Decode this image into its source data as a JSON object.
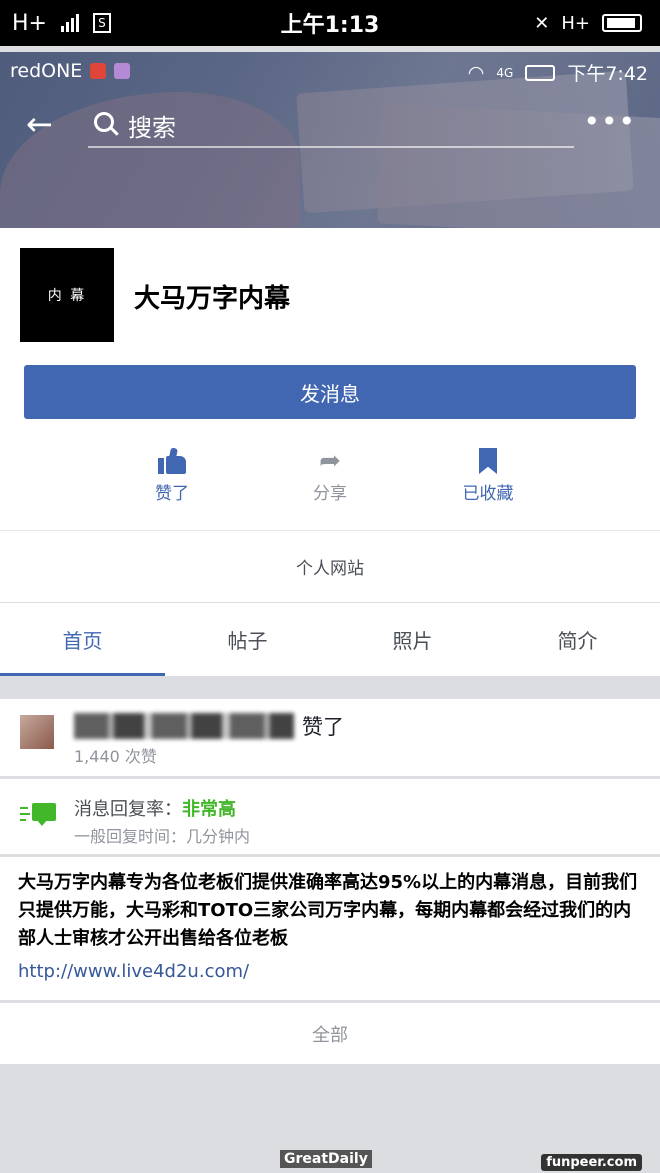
{
  "outer_status": {
    "network": "H+",
    "time": "上午1:13",
    "right_network": "H+"
  },
  "inner_status": {
    "carrier": "redONE",
    "network": "4G",
    "time": "下午7:42"
  },
  "search": {
    "placeholder": "搜索"
  },
  "page": {
    "avatar_text": "内 幕",
    "name": "大马万字内幕"
  },
  "message_button": "发消息",
  "actions": [
    {
      "label": "赞了",
      "icon": "thumbs-up-icon"
    },
    {
      "label": "分享",
      "icon": "share-icon"
    },
    {
      "label": "已收藏",
      "icon": "bookmark-icon"
    }
  ],
  "website_label": "个人网站",
  "tabs": [
    "首页",
    "帖子",
    "照片",
    "简介"
  ],
  "likes": {
    "suffix": "赞了",
    "count": "1,440 次赞"
  },
  "reply": {
    "label": "消息回复率：",
    "value": "非常高",
    "time": "一般回复时间：几分钟内"
  },
  "about": {
    "text": "大马万字内幕专为各位老板们提供准确率高达95%以上的内幕消息，目前我们只提供万能，大马彩和TOTO三家公司万字内幕，每期内幕都会经过我们的内部人士审核才公开出售给各位老板",
    "link": "http://www.live4d2u.com/"
  },
  "all_label": "全部",
  "watermarks": {
    "left": "GreatDaily",
    "right": "funpeer.com"
  },
  "colors": {
    "facebook_blue": "#4267b2",
    "green": "#42b72a"
  }
}
